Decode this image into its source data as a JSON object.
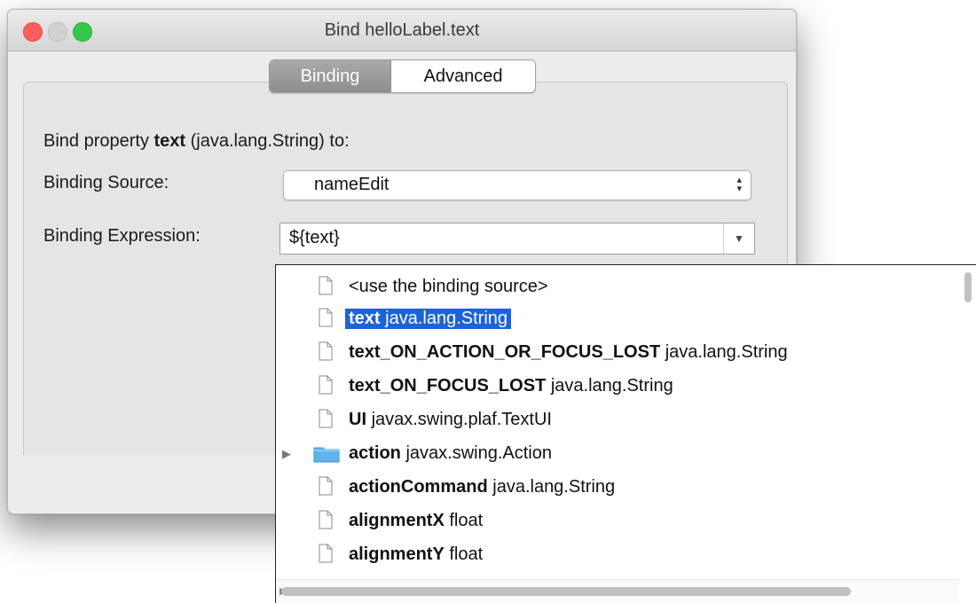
{
  "window": {
    "title": "Bind helloLabel.text",
    "traffic_lights": [
      "close",
      "minimize",
      "zoom"
    ]
  },
  "tabs": [
    {
      "label": "Binding",
      "selected": true
    },
    {
      "label": "Advanced",
      "selected": false
    }
  ],
  "form": {
    "intro_prefix": "Bind property ",
    "intro_property": "text",
    "intro_suffix": " (java.lang.String) to:",
    "binding_source_label": "Binding Source:",
    "binding_source_value": "nameEdit",
    "binding_expression_label": "Binding Expression:",
    "binding_expression_value": "${text}"
  },
  "dropdown": {
    "items": [
      {
        "name": "<use the binding source>",
        "type": "",
        "icon": "document-icon",
        "bold": false
      },
      {
        "name": "text",
        "type": "java.lang.String",
        "icon": "document-icon",
        "bold": true,
        "selected": true
      },
      {
        "name": "text_ON_ACTION_OR_FOCUS_LOST",
        "type": "java.lang.String",
        "icon": "document-icon",
        "bold": true
      },
      {
        "name": "text_ON_FOCUS_LOST",
        "type": "java.lang.String",
        "icon": "document-icon",
        "bold": true
      },
      {
        "name": "UI",
        "type": "javax.swing.plaf.TextUI",
        "icon": "document-icon",
        "bold": true
      },
      {
        "name": "action",
        "type": "javax.swing.Action",
        "icon": "folder-icon",
        "bold": true,
        "expandable": true
      },
      {
        "name": "actionCommand",
        "type": "java.lang.String",
        "icon": "document-icon",
        "bold": true
      },
      {
        "name": "alignmentX",
        "type": "float",
        "icon": "document-icon",
        "bold": true
      },
      {
        "name": "alignmentY",
        "type": "float",
        "icon": "document-icon",
        "bold": true
      }
    ]
  },
  "colors": {
    "selection": "#1d62d8",
    "close": "#fc605c",
    "zoom": "#34c84a",
    "folder": "#5fb4ee"
  }
}
